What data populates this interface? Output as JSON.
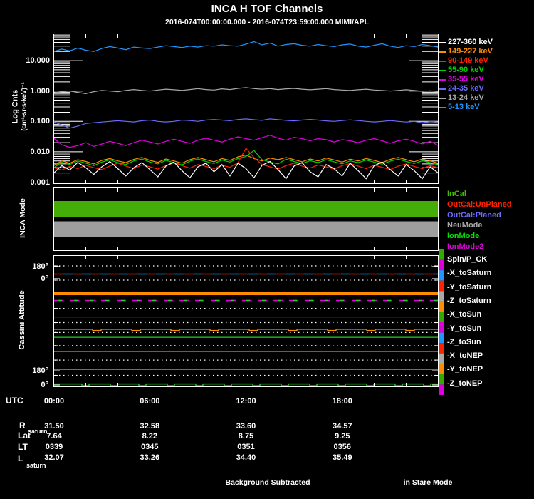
{
  "title": "INCA H TOF Channels",
  "subtitle": "2016-074T00:00:00.000 - 2016-074T23:59:00.000 MIMI/APL",
  "footer": {
    "background_note": "Background Subtracted",
    "mode_note": "in Stare Mode"
  },
  "spectra": {
    "ylabel_main": "Log Cnts",
    "ylabel_units": "(cm²-sr-s-keV)⁻¹",
    "ytick_labels": [
      "10.000",
      "1.000",
      "0.100",
      "0.010",
      "0.001"
    ]
  },
  "mode_panel": {
    "ylabel": "INCA Mode"
  },
  "attitude": {
    "ylabel": "Cassini Attitude"
  },
  "bottom_axis": {
    "utc_label": "UTC",
    "times": [
      "00:00",
      "06:00",
      "12:00",
      "18:00"
    ],
    "rows": [
      {
        "label": "R",
        "sub": "saturn",
        "values": [
          "31.50",
          "32.58",
          "33.60",
          "34.57"
        ]
      },
      {
        "label": "Lat",
        "sub": "",
        "values": [
          "7.64",
          "8.22",
          "8.75",
          "9.25"
        ]
      },
      {
        "label": "LT",
        "sub": "",
        "values": [
          "0339",
          "0345",
          "0351",
          "0356"
        ]
      },
      {
        "label": "L",
        "sub": "saturn",
        "values": [
          "32.07",
          "33.26",
          "34.40",
          "35.49"
        ]
      }
    ]
  },
  "chart_data": [
    {
      "type": "line",
      "title": "INCA H TOF Channels count-rate spectra",
      "xlabel": "UTC",
      "ylabel": "Log Cnts (cm²-sr-s-keV)⁻¹",
      "y_log": true,
      "y_range": [
        0.001,
        70
      ],
      "y_ticks": [
        10,
        1,
        0.1,
        0.01,
        0.001
      ],
      "x_range_hours": [
        0,
        24
      ],
      "x_tick_labels": [
        "00:00",
        "06:00",
        "12:00",
        "18:00"
      ],
      "x_start_hour": 0,
      "x_step_hour": 0.5,
      "legend_position": "right",
      "series": [
        {
          "name": "227-360 keV",
          "color": "#ffffff",
          "values": [
            0.002,
            0.0035,
            0.0025,
            0.0045,
            0.003,
            0.0018,
            0.0032,
            0.0048,
            0.0028,
            0.0016,
            0.003,
            0.0044,
            0.0026,
            0.0015,
            0.0034,
            0.0046,
            0.0024,
            0.0014,
            0.0032,
            0.0042,
            0.0022,
            0.0038,
            0.0016,
            0.0042,
            0.0028,
            0.0014,
            0.0036,
            0.0048,
            0.0026,
            0.0013,
            0.0034,
            0.0044,
            0.0022,
            0.0015,
            0.0038,
            0.0028,
            0.0016,
            0.0042,
            0.0024,
            0.0013,
            0.0035,
            0.0046,
            0.0026,
            0.0016,
            0.0038,
            0.0024,
            0.0013,
            0.0032,
            0.002
          ]
        },
        {
          "name": "149-227 keV",
          "color": "#ff8c00",
          "values": [
            0.0035,
            0.005,
            0.0042,
            0.0055,
            0.0048,
            0.004,
            0.0052,
            0.006,
            0.005,
            0.0044,
            0.0056,
            0.0065,
            0.0052,
            0.0045,
            0.0058,
            0.005,
            0.0042,
            0.0055,
            0.0065,
            0.0055,
            0.0047,
            0.006,
            0.0052,
            0.0068,
            0.0078,
            0.006,
            0.005,
            0.0062,
            0.0055,
            0.0065,
            0.0055,
            0.0047,
            0.0058,
            0.005,
            0.0062,
            0.0054,
            0.0046,
            0.0057,
            0.005,
            0.006,
            0.0052,
            0.0044,
            0.0056,
            0.0065,
            0.0055,
            0.0047,
            0.0058,
            0.005,
            0.0042
          ]
        },
        {
          "name": "90-149 keV",
          "color": "#ff2200",
          "values": [
            0.003,
            0.0025,
            0.0033,
            0.0028,
            0.0036,
            0.003,
            0.0026,
            0.0034,
            0.0042,
            0.0034,
            0.0028,
            0.0037,
            0.0032,
            0.0027,
            0.0035,
            0.0043,
            0.0035,
            0.0029,
            0.0038,
            0.0033,
            0.0028,
            0.0036,
            0.0031,
            0.0044,
            0.013,
            0.0065,
            0.0038,
            0.0032,
            0.0027,
            0.0035,
            0.0042,
            0.0034,
            0.0029,
            0.0037,
            0.0032,
            0.0027,
            0.0035,
            0.0041,
            0.0034,
            0.0028,
            0.0036,
            0.0031,
            0.0026,
            0.0034,
            0.004,
            0.0033,
            0.0028,
            0.0035,
            0.003
          ]
        },
        {
          "name": "55-90 keV",
          "color": "#00d400",
          "values": [
            0.003,
            0.0045,
            0.0038,
            0.005,
            0.0042,
            0.0035,
            0.0046,
            0.0054,
            0.0044,
            0.0038,
            0.005,
            0.0058,
            0.0046,
            0.004,
            0.0052,
            0.0044,
            0.0037,
            0.0049,
            0.0058,
            0.0048,
            0.0041,
            0.0053,
            0.0046,
            0.006,
            0.007,
            0.011,
            0.0055,
            0.0046,
            0.004,
            0.0057,
            0.0048,
            0.0041,
            0.0051,
            0.0044,
            0.0055,
            0.0047,
            0.004,
            0.005,
            0.0044,
            0.0053,
            0.0046,
            0.0039,
            0.0049,
            0.0057,
            0.0048,
            0.0041,
            0.0051,
            0.0044,
            0.0037
          ]
        },
        {
          "name": "35-55 keV",
          "color": "#e000e0",
          "values": [
            0.028,
            0.017,
            0.014,
            0.016,
            0.02,
            0.015,
            0.018,
            0.022,
            0.019,
            0.016,
            0.02,
            0.024,
            0.021,
            0.018,
            0.022,
            0.026,
            0.022,
            0.019,
            0.024,
            0.028,
            0.024,
            0.021,
            0.026,
            0.031,
            0.027,
            0.024,
            0.029,
            0.035,
            0.028,
            0.024,
            0.03,
            0.027,
            0.023,
            0.027,
            0.025,
            0.021,
            0.025,
            0.023,
            0.02,
            0.024,
            0.027,
            0.023,
            0.019,
            0.023,
            0.026,
            0.022,
            0.018,
            0.022,
            0.016
          ]
        },
        {
          "name": "24-35 keV",
          "color": "#6b6bff",
          "values": [
            0.1,
            0.075,
            0.06,
            0.07,
            0.085,
            0.09,
            0.095,
            0.1,
            0.105,
            0.1,
            0.096,
            0.105,
            0.11,
            0.1,
            0.096,
            0.1,
            0.11,
            0.106,
            0.1,
            0.11,
            0.115,
            0.11,
            0.105,
            0.115,
            0.12,
            0.113,
            0.108,
            0.12,
            0.114,
            0.108,
            0.104,
            0.11,
            0.116,
            0.11,
            0.104,
            0.1,
            0.106,
            0.112,
            0.106,
            0.1,
            0.096,
            0.1,
            0.106,
            0.1,
            0.095,
            0.1,
            0.09,
            0.1,
            0.096
          ]
        },
        {
          "name": "13-24 keV",
          "color": "#a8a8a8",
          "values": [
            0.85,
            0.95,
            1.0,
            0.9,
            0.82,
            0.95,
            1.05,
            1.0,
            0.95,
            1.05,
            1.12,
            1.05,
            1.0,
            1.08,
            1.15,
            1.1,
            1.05,
            1.12,
            1.2,
            1.12,
            1.08,
            1.18,
            1.12,
            1.22,
            1.3,
            1.2,
            1.15,
            1.2,
            1.12,
            1.18,
            1.22,
            1.15,
            1.1,
            1.15,
            1.2,
            1.12,
            1.08,
            1.05,
            1.1,
            1.15,
            1.08,
            1.05,
            1.0,
            1.05,
            1.1,
            1.05,
            0.98,
            1.02,
            0.95
          ]
        },
        {
          "name": "5-13 keV",
          "color": "#2196ff",
          "values": [
            20,
            24,
            21,
            26,
            22,
            20,
            25,
            29,
            26,
            23,
            28,
            26,
            25,
            28,
            31,
            29,
            27,
            30,
            28,
            31,
            30,
            33,
            31,
            30,
            35,
            42,
            33,
            38,
            30,
            34,
            36,
            32,
            30,
            34,
            31,
            29,
            33,
            35,
            30,
            28,
            32,
            36,
            30,
            27,
            31,
            29,
            34,
            31,
            28
          ]
        }
      ]
    },
    {
      "type": "bands",
      "title": "INCA Mode",
      "legend": [
        {
          "label": "InCal",
          "color": "#44bb00"
        },
        {
          "label": "OutCal:UnPlaned",
          "color": "#ff2200"
        },
        {
          "label": "OutCal:Planed",
          "color": "#6b6bff"
        },
        {
          "label": "NeuMode",
          "color": "#a8a8a8"
        },
        {
          "label": "IonMode",
          "color": "#00e600"
        },
        {
          "label": "IonMode2",
          "color": "#e000e0"
        }
      ],
      "bands": [
        {
          "color": "#45ad08",
          "y0_frac": 0.213,
          "y1_frac": 0.461
        },
        {
          "color": "#9e9e9e",
          "y0_frac": 0.534,
          "y1_frac": 0.787
        }
      ]
    },
    {
      "type": "line",
      "title": "Cassini Attitude",
      "y_tick_labels": [
        {
          "label": "180°",
          "frac": 0.086
        },
        {
          "label": "0°",
          "frac": 0.178
        },
        {
          "label": "180°",
          "frac": 0.876
        },
        {
          "label": "0°",
          "frac": 0.984
        }
      ],
      "legend": [
        "Spin/P_CK",
        "-X_toSaturn",
        "-Y_toSaturn",
        "-Z_toSaturn",
        "-X_toSun",
        "-Y_toSun",
        "-Z_toSun",
        "-X_toNEP",
        "-Y_toNEP",
        "-Z_toNEP"
      ],
      "colorbar_cycle": [
        "#33aa00",
        "#dd00dd",
        "#2196ff",
        "#ff2200",
        "#a8a8a8",
        "#ff8c00"
      ],
      "guides_frac": [
        0.081,
        0.189,
        0.403,
        0.511,
        0.586,
        0.686,
        0.795,
        0.911
      ],
      "lines": [
        {
          "style": "dash-alt",
          "colors": [
            "#ff2200",
            "#2196ff"
          ],
          "y_frac": 0.143,
          "width": 1.6
        },
        {
          "style": "solid",
          "colors": [
            "#ff8c00"
          ],
          "y_frac": 0.292,
          "width": 4
        },
        {
          "style": "dash-two",
          "colors": [
            "#dd00dd",
            "#22cc22"
          ],
          "y_frac": 0.343,
          "width": 1.6
        },
        {
          "style": "solid",
          "colors": [
            "#ff2200"
          ],
          "y_frac": 0.468,
          "width": 1.3
        },
        {
          "style": "notched",
          "colors": [
            "#ff8c00"
          ],
          "y_frac": 0.562,
          "width": 1.3,
          "amp": 1.5,
          "period": 55,
          "notch_w": 12
        },
        {
          "style": "solid",
          "colors": [
            "#22cc22"
          ],
          "y_frac": 0.622,
          "width": 1.3
        },
        {
          "style": "solid",
          "colors": [
            "#2196ff"
          ],
          "y_frac": 0.73,
          "width": 1.5
        },
        {
          "style": "solid",
          "colors": [
            "#b0b0b0"
          ],
          "y_frac": 0.865,
          "width": 1.3
        },
        {
          "style": "notched",
          "colors": [
            "#22cc22"
          ],
          "y_frac": 0.976,
          "width": 1.5,
          "amp": 2.5,
          "period": 40,
          "notch_w": 10
        }
      ]
    }
  ]
}
